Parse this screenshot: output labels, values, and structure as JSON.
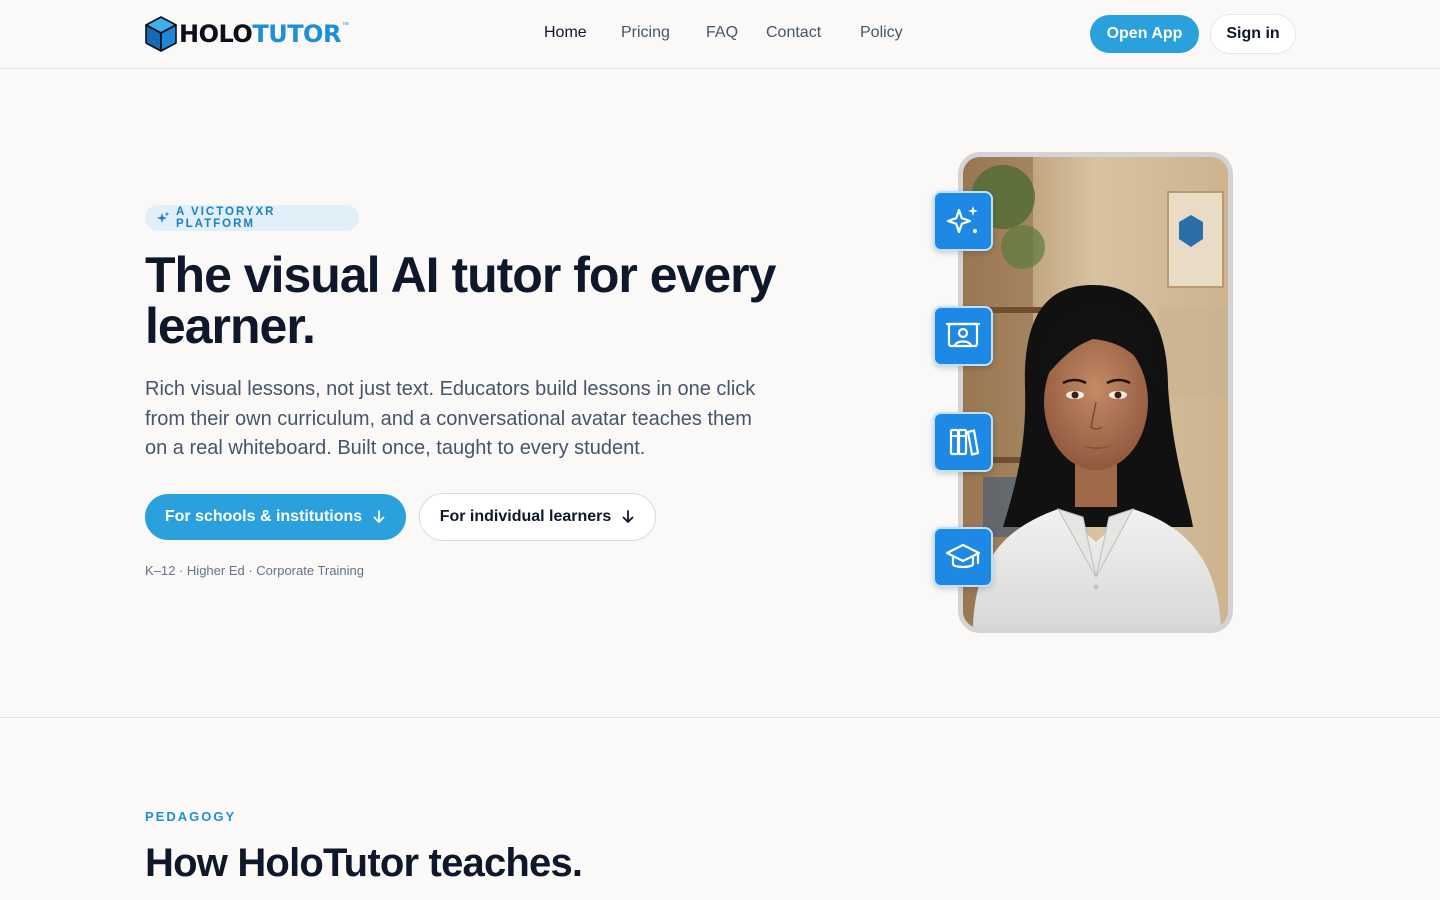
{
  "brand": {
    "name_part1": "HOLO",
    "name_part2": "TUTOR",
    "trademark": "™",
    "primary_color": "#2aa0dc",
    "logo_accent": "#1d8fd6"
  },
  "nav": {
    "items": [
      {
        "label": "Home",
        "active": true
      },
      {
        "label": "Pricing",
        "active": false
      },
      {
        "label": "FAQ",
        "active": false
      },
      {
        "label": "Contact",
        "active": false
      },
      {
        "label": "Policy",
        "active": false
      }
    ]
  },
  "header_actions": {
    "open_app": "Open App",
    "sign_in": "Sign in"
  },
  "hero": {
    "badge": "A VICTORYXR PLATFORM",
    "title": "The visual AI tutor for every learner.",
    "description": "Rich visual lessons, not just text. Educators build lessons in one click from their own curriculum, and a conversational avatar teaches them on a real whiteboard. Built once, taught to every student.",
    "cta_primary": "For schools & institutions",
    "cta_secondary": "For individual learners",
    "audience": "K–12 · Higher Ed · Corporate Training"
  },
  "feature_icons": [
    "sparkles-icon",
    "whiteboard-presenter-icon",
    "books-icon",
    "graduation-cap-icon"
  ],
  "section": {
    "eyebrow": "PEDAGOGY",
    "title": "How HoloTutor teaches."
  }
}
